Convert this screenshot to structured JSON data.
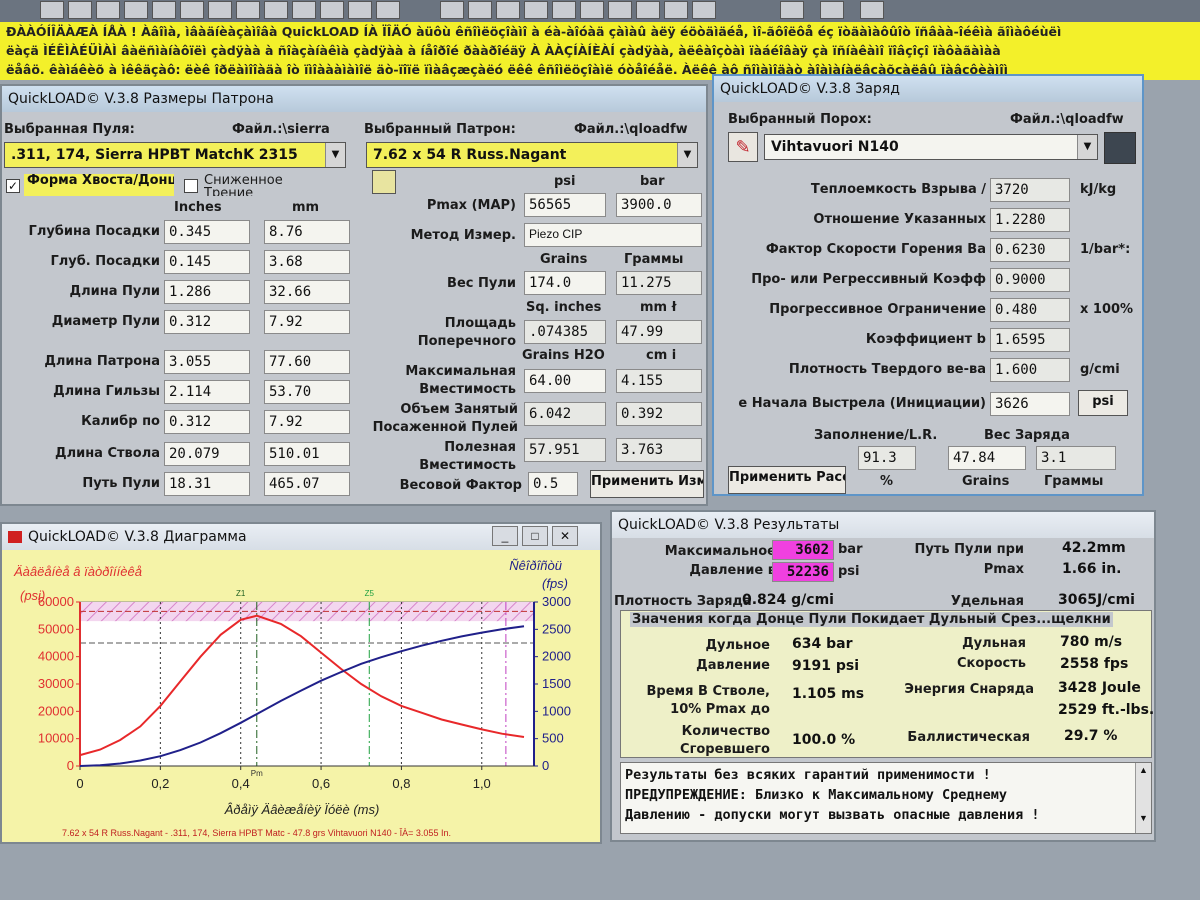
{
  "banner": {
    "line1": "ĐÀÀÓÍÎÄÀÆÀ ÍÅÀ ! Àâîìà, ìâàäíèàçàìîâà QuickLOAD ÍÀ ÏÎÄÓ àüôù êñîìëöçîàìî à éà-àîóàä çàìàû àëÿ éöòäìäéå, ìî-ãôîëôå éç ïòäàìàôûîò ïñâàà-îéêìà ãîìàôéùëì",
    "line2": "ëàçä ÌÉÊÌÀÉÜÌÀÌ âàëñìàíàôïëì çàdÿàà à ñîàçàíàêìà çàdÿàà à íåîðîé ðààðîéäÿ À ÀÀÇÍÀÍÈÀÍ çàdÿàà, àëêàîçòàì ïàáéîâàÿ çà ïñíàêàìî ïîâçîçî ïàôàãàìàà",
    "line3": "ëåâö. êàìáêèõ à ìêêäçàô: ëèê îðëàìîîàäà îò ïìîàààìàìîë äò-ïîïë ïìàâçæçàëó ëêê êñîìëöçîàìë óòåîéåë. Àëêê àô ñîìàìîäàò àîàìàíàëâçàõçàëâû ïàâçôèàìîì"
  },
  "cartridge_window": {
    "title": "QuickLOAD© V.3.8 Размеры Патрона",
    "bullet_label": "Выбранная Пуля:",
    "bullet_file_label": "Файл.:\\sierra",
    "bullet_value": ".311, 174, Sierra HPBT MatchK 2315",
    "cartridge_label": "Выбранный Патрон:",
    "cartridge_file_label": "Файл.:\\qloadfw",
    "cartridge_value": "7.62 x 54 R Russ.Nagant",
    "check1_label": "Форма Хвоста/Донца",
    "check2_label": "Сниженное Трение",
    "unit_inches": "Inches",
    "unit_mm": "mm",
    "rows": [
      {
        "label": "Глубина Посадки",
        "inches": "0.345",
        "mm": "8.76"
      },
      {
        "label": "Глуб. Посадки",
        "inches": "0.145",
        "mm": "3.68"
      },
      {
        "label": "Длина Пули",
        "inches": "1.286",
        "mm": "32.66"
      },
      {
        "label": "Диаметр Пули",
        "inches": "0.312",
        "mm": "7.92"
      },
      {
        "label": "Длина Патрона",
        "inches": "3.055",
        "mm": "77.60"
      },
      {
        "label": "Длина Гильзы",
        "inches": "2.114",
        "mm": "53.70"
      },
      {
        "label": "Калибр по",
        "inches": "0.312",
        "mm": "7.92"
      },
      {
        "label": "Длина Ствола",
        "inches": "20.079",
        "mm": "510.01"
      },
      {
        "label": "Путь Пули",
        "inches": "18.31",
        "mm": "465.07"
      }
    ],
    "unit_psi": "psi",
    "unit_bar": "bar",
    "pmax_label": "Pmax (MAP)",
    "pmax_psi": "56565",
    "pmax_bar": "3900.0",
    "method_label": "Метод Измер.",
    "method_value": "Piezo CIP",
    "unit_grains": "Grains",
    "unit_grams": "Граммы",
    "bullet_weight_label": "Вес Пули",
    "bullet_weight_gr": "174.0",
    "bullet_weight_g": "11.275",
    "unit_sqin": "Sq. inches",
    "unit_mm2": "mm ł",
    "area_label1": "Площадь",
    "area_label2": "Поперечного",
    "area_sqin": ".074385",
    "area_mm2": "47.99",
    "unit_grh2o": "Grains H2O",
    "unit_cm3": "cm i",
    "capacity_label1": "Максимальная",
    "capacity_label2": "Вместимость",
    "capacity_gr": "64.00",
    "capacity_cm3": "4.155",
    "occupied_label1": "Объем Занятый",
    "occupied_label2": "Посаженной Пулей",
    "occupied_gr": "6.042",
    "occupied_cm3": "0.392",
    "useful_label1": "Полезная",
    "useful_label2": "Вместимость",
    "useful_gr": "57.951",
    "useful_cm3": "3.763",
    "weight_factor_label": "Весовой Фактор",
    "weight_factor_value": "0.5",
    "apply_button": "Применить Изменения"
  },
  "charge_window": {
    "title": "QuickLOAD© V.3.8 Заряд",
    "powder_label": "Выбранный Порох:",
    "powder_file_label": "Файл.:\\qloadfw",
    "powder_value": "Vihtavuori N140",
    "rows": [
      {
        "label": "Теплоемкость Взрыва /",
        "value": "3720",
        "unit": "kJ/kg"
      },
      {
        "label": "Отношение Указанных",
        "value": "1.2280",
        "unit": ""
      },
      {
        "label": "Фактор Скорости Горения  Ba",
        "value": "0.6230",
        "unit": "1/bar*:"
      },
      {
        "label": "Про- или Регрессивный Коэфф",
        "value": "0.9000",
        "unit": ""
      },
      {
        "label": "Прогрессивное Ограничение",
        "value": "0.480",
        "unit": "x 100%"
      },
      {
        "label": "Коэффициент b",
        "value": "1.6595",
        "unit": ""
      },
      {
        "label": "Плотность Твердого ве-ва",
        "value": "1.600",
        "unit": "g/cmi"
      },
      {
        "label": "е Начала Выстрела (Инициации)",
        "value": "3626",
        "unit": "psi"
      }
    ],
    "fill_label": "Заполнение/L.R.",
    "charge_weight_label": "Вес Заряда",
    "fill_value": "91.3",
    "fill_unit": "%",
    "charge_grains": "47.84",
    "charge_grains_unit": "Grains",
    "charge_grams": "3.1",
    "charge_grams_unit": "Граммы",
    "apply_button": "Применить Рассч"
  },
  "diagram_window": {
    "title": "QuickLOAD© V.3.8 Диаграмма",
    "left_axis_title": "Äàâëåíèå â ïàòðîííèêå",
    "left_axis_unit": "(psi)",
    "right_axis_title": "Ñêîðîñòü",
    "right_axis_unit": "(fps)",
    "x_axis_title": "Âðåìÿ Äâèæåíèÿ Ïóëè (ms)",
    "legend": "7.62 x 54 R Russ.Nagant - .311, 174, Sierra HPBT Matc - 47.8 grs Vihtavuori N140 - ÎÀ= 3.055 In."
  },
  "chart_data": {
    "type": "line",
    "xlabel": "Âðåìÿ Äâèæåíèÿ Ïóëè (ms)",
    "x_ticks": [
      "0",
      "0,2",
      "0,4",
      "0,6",
      "0,8",
      "1,0"
    ],
    "xlim": [
      0,
      1.13
    ],
    "y_left_ticks": [
      "0",
      "10000",
      "20000",
      "30000",
      "40000",
      "50000",
      "60000"
    ],
    "ylim_left": [
      0,
      60000
    ],
    "y_right_ticks": [
      "0",
      "500",
      "1000",
      "1500",
      "2000",
      "2500",
      "3000"
    ],
    "ylim_right": [
      0,
      3000
    ],
    "series": [
      {
        "axis": "left",
        "color": "#e8282a",
        "x": [
          0,
          0.05,
          0.1,
          0.15,
          0.2,
          0.25,
          0.3,
          0.35,
          0.4,
          0.44,
          0.5,
          0.55,
          0.6,
          0.65,
          0.7,
          0.75,
          0.8,
          0.85,
          0.9,
          0.95,
          1.0,
          1.05,
          1.105
        ],
        "y": [
          4000,
          6000,
          9500,
          14500,
          22000,
          31000,
          40000,
          48000,
          53500,
          55000,
          52000,
          47500,
          41500,
          35500,
          30000,
          25500,
          22000,
          19500,
          17000,
          15200,
          13400,
          11800,
          10600
        ]
      },
      {
        "axis": "right",
        "color": "#20208a",
        "x": [
          0,
          0.05,
          0.1,
          0.15,
          0.2,
          0.25,
          0.3,
          0.35,
          0.4,
          0.45,
          0.5,
          0.55,
          0.6,
          0.65,
          0.7,
          0.75,
          0.8,
          0.85,
          0.9,
          0.95,
          1.0,
          1.05,
          1.105
        ],
        "y": [
          0,
          15,
          45,
          100,
          180,
          290,
          430,
          600,
          790,
          990,
          1190,
          1380,
          1560,
          1720,
          1870,
          1990,
          2100,
          2200,
          2290,
          2370,
          2440,
          2500,
          2558
        ]
      }
    ],
    "pmax_band": [
      53000,
      60000
    ],
    "marker_labels": [
      "Pm",
      "Z1",
      "Z5"
    ]
  },
  "results_window": {
    "title": "QuickLOAD© V.3.8 Результаты",
    "max_label1": "Максимальное",
    "max_label2": "Давление в",
    "max_bar": "3602",
    "max_bar_unit": "bar",
    "max_psi": "52236",
    "max_psi_unit": "psi",
    "path_label1": "Путь Пули при",
    "path_label2": "Pmax",
    "path_mm": "42.2mm",
    "path_in": "1.66 in.",
    "density_label": "Плотность Заряда",
    "density_value": "0.824 g/cmi",
    "specific_label": "Удельная",
    "specific_value": "3065J/cmi",
    "section_title": "Значения когда Донце Пули Покидает Дульный Срез...щелкни",
    "muzzle_p_label1": "Дульное",
    "muzzle_p_label2": "Давление",
    "muzzle_bar": "634 bar",
    "muzzle_psi": "9191 psi",
    "muzzle_v_label1": "Дульная",
    "muzzle_v_label2": "Скорость",
    "muzzle_ms": "780 m/s",
    "muzzle_fps": "2558 fps",
    "time_label1": "Время В Стволе,",
    "time_label2": "10% Pmax до",
    "time_value": "1.105 ms",
    "energy_label": "Энергия Снаряда",
    "energy_joule": "3428 Joule",
    "energy_ftlbs": "2529 ft.-lbs.",
    "burnt_label1": "Количество",
    "burnt_label2": "Сгоревшего",
    "burnt_value": "100.0 %",
    "ballistic_label": "Баллистическая",
    "ballistic_value": "29.7 %",
    "message_line1": "Результаты без всяких гарантий применимости !",
    "message_line2": "ПРЕДУПРЕЖДЕНИЕ: Близко к Максимальному Среднему",
    "message_line3": "Давлению - допуски могут вызвать опасные давления !"
  }
}
